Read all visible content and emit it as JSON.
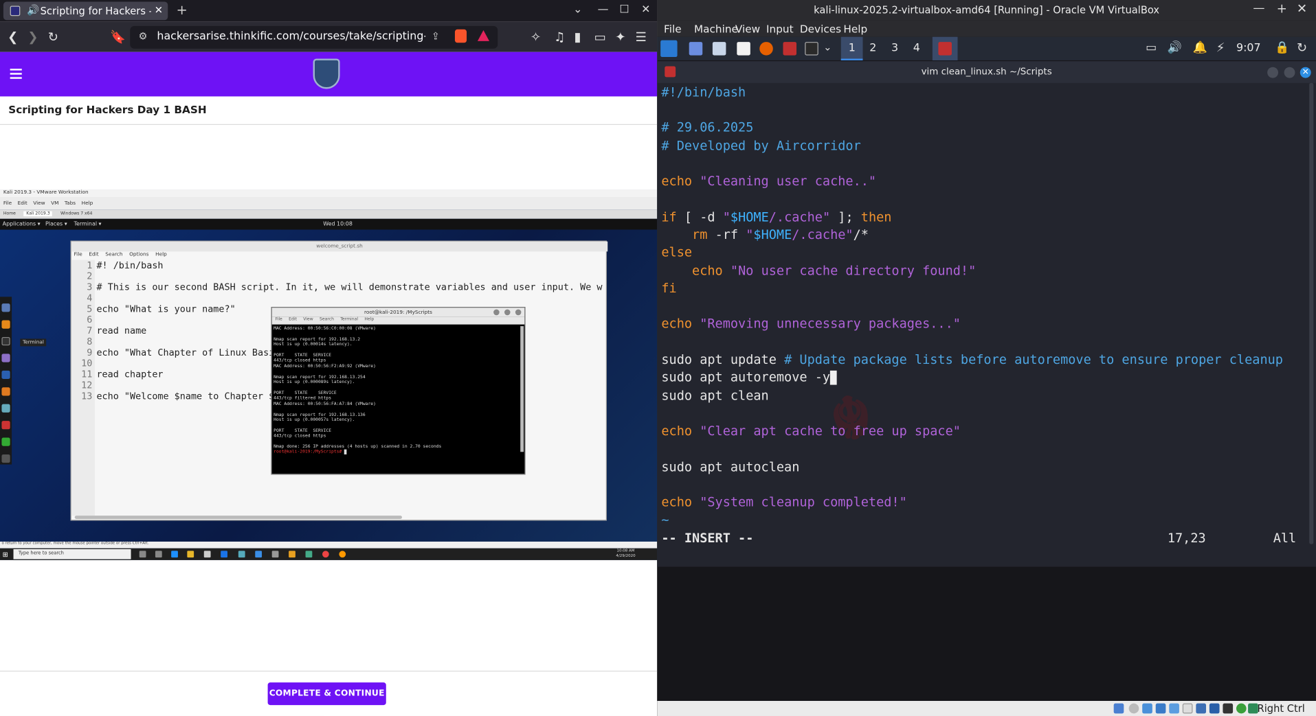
{
  "browser": {
    "tab_title": "Scripting for Hackers - Hac",
    "url": "hackersarise.thinkific.com/courses/take/scripting-for-hac...",
    "course_title": "Scripting for Hackers Day 1 BASH",
    "complete_button": "COMPLETE & CONTINUE →"
  },
  "video": {
    "vm_title": "Kali 2019.3 - VMware Workstation",
    "vm_menu": [
      "File",
      "Edit",
      "View",
      "VM",
      "Tabs",
      "Help"
    ],
    "vm_tabs": [
      "Home",
      "Kali 2019.3",
      "Windows 7 x64"
    ],
    "gnome": {
      "applications": "Applications ▾",
      "places": "Places ▾",
      "terminal": "Terminal ▾",
      "clock": "Wed 10:08"
    },
    "gedit_title": "welcome_script.sh",
    "gedit_menu": [
      "File",
      "Edit",
      "Search",
      "Options",
      "Help"
    ],
    "lines": [
      "#! /bin/bash",
      "",
      "# This is our second BASH script. In it, we will demonstrate variables and user input. We wi",
      "",
      "echo \"What is your name?\"",
      "",
      "read name",
      "",
      "echo \"What Chapter of Linux Basi",
      "",
      "read chapter",
      "",
      "echo \"Welcome $name to Chapter $"
    ],
    "line_numbers": [
      "1",
      "2",
      "3",
      "4",
      "5",
      "6",
      "7",
      "8",
      "9",
      "10",
      "11",
      "12",
      "13"
    ],
    "terminal_title": "root@kali-2019: /MyScripts",
    "terminal_menu": [
      "File",
      "Edit",
      "View",
      "Search",
      "Terminal",
      "Help"
    ],
    "terminal_text": "MAC Address: 00:50:56:C0:00:08 (VMware)\n\nNmap scan report for 192.168.13.2\nHost is up (0.00014s latency).\n\nPORT    STATE  SERVICE\n443/tcp closed https\nMAC Address: 00:50:56:F2:A9:92 (VMware)\n\nNmap scan report for 192.168.13.254\nHost is up (0.000089s latency).\n\nPORT    STATE    SERVICE\n443/tcp filtered https\nMAC Address: 00:50:56:FA:A7:84 (VMware)\n\nNmap scan report for 192.168.13.136\nHost is up (0.000057s latency).\n\nPORT    STATE  SERVICE\n443/tcp closed https\n\nNmap done: 256 IP addresses (4 hosts up) scanned in 2.70 seconds",
    "terminal_prompt": "root@kali-2019:/MyScripts# ",
    "tooltip": "Terminal",
    "vm_status": "o return to your computer, move the mouse pointer outside or press Ctrl+Alt.",
    "win_search": "Type here to search",
    "win_time": "10:08 AM",
    "win_date": "4/29/2020"
  },
  "vbox": {
    "title": "kali-linux-2025.2-virtualbox-amd64 [Running] - Oracle VM VirtualBox",
    "menu": [
      "File",
      "Machine",
      "View",
      "Input",
      "Devices",
      "Help"
    ],
    "workspaces": [
      "1",
      "2",
      "3",
      "4"
    ],
    "clock": "9:07",
    "vim_title": "vim clean_linux.sh ~/Scripts",
    "mode": "-- INSERT --",
    "position": "17,23",
    "scroll": "All",
    "right_ctrl": "Right Ctrl",
    "code": {
      "shebang": "#!/bin/bash",
      "date": "# 29.06.2025",
      "dev": "# Developed by Aircorridor",
      "echo1_kw": "echo",
      "echo1_str": " \"Cleaning user cache..\"",
      "if_kw": "if",
      "if_a": " [ -d ",
      "if_s1": "\"",
      "if_v": "$HOME",
      "if_s2": "/.cache\"",
      "if_b": " ]; ",
      "then_kw": "then",
      "rm_kw": "    rm",
      "rm_a": " -rf ",
      "rm_s1": "\"",
      "rm_v": "$HOME",
      "rm_s2": "/.cache\"",
      "rm_b": "/*",
      "else_kw": "else",
      "echo2_kw": "    echo",
      "echo2_str": " \"No user cache directory found!\"",
      "fi_kw": "fi",
      "echo3_kw": "echo",
      "echo3_str": " \"Removing unnecessary packages...\"",
      "upd_a": "sudo apt update ",
      "upd_c": "# Update package lists before autoremove to ensure proper cleanup",
      "autoremove": "sudo apt autoremove -y",
      "clean": "sudo apt clean",
      "echo4_kw": "echo",
      "echo4_str": " \"Clear apt cache to free up space\"",
      "autoclean": "sudo apt autoclean",
      "echo5_kw": "echo",
      "echo5_str": " \"System cleanup completed!\"",
      "tilde": "~"
    }
  }
}
